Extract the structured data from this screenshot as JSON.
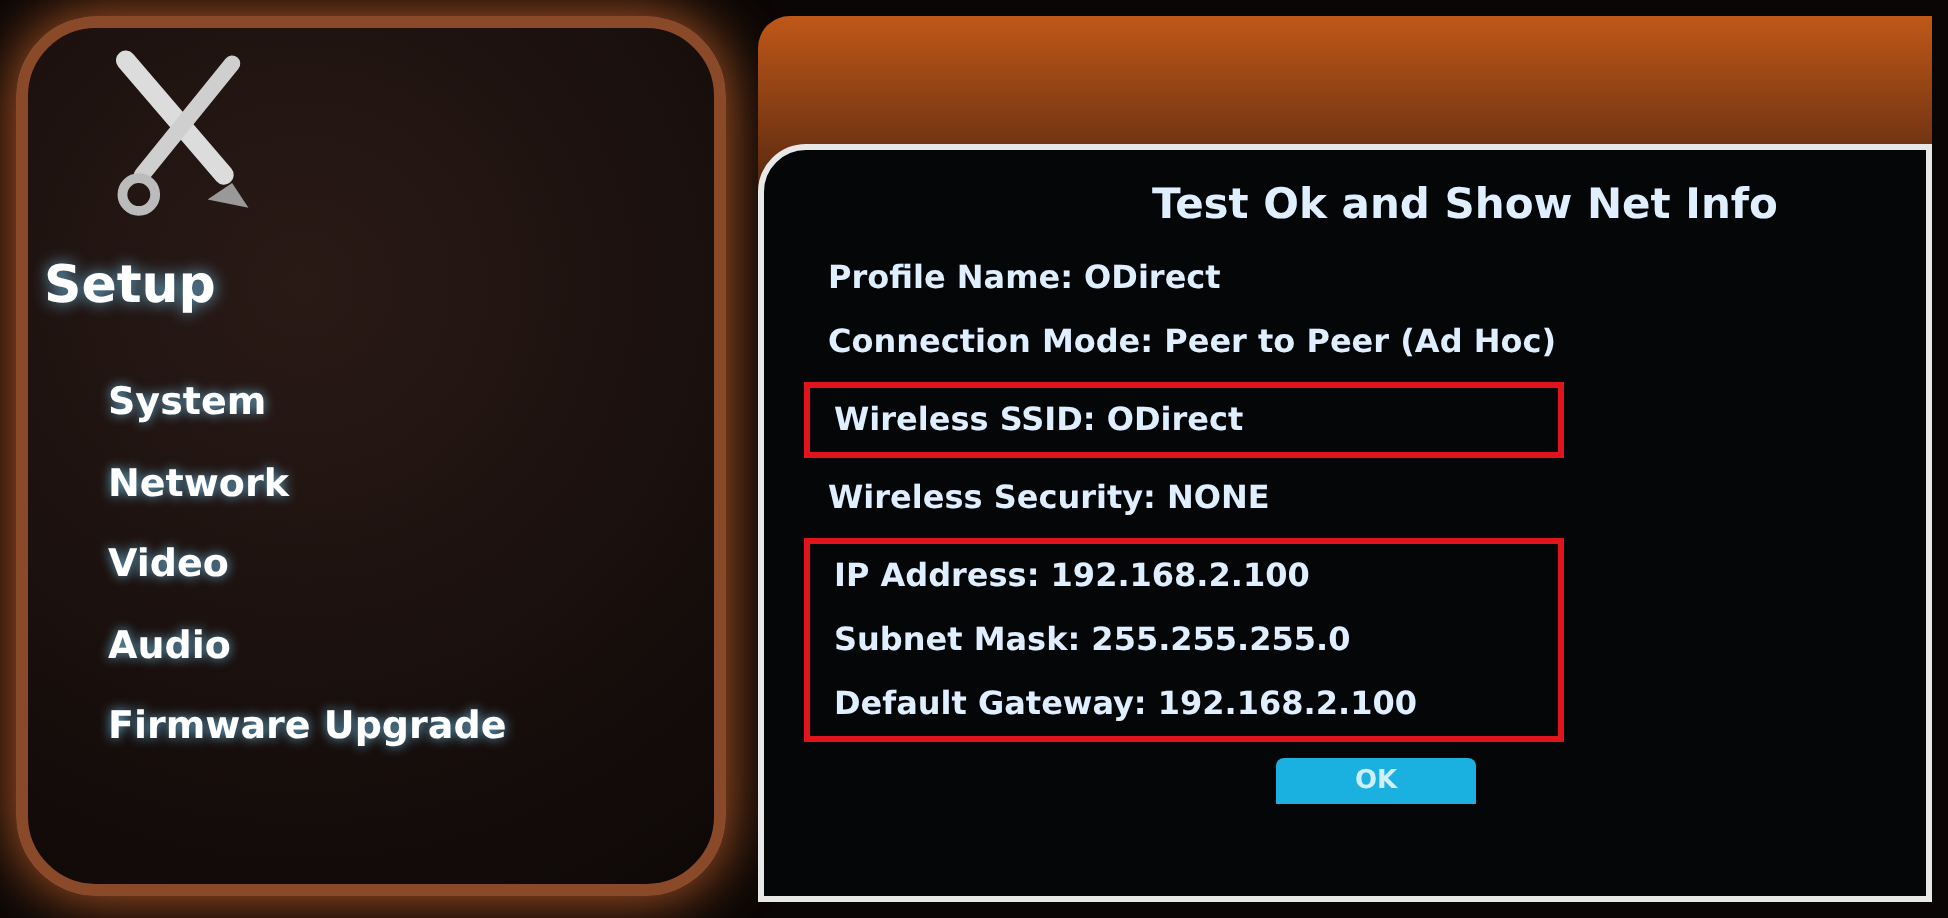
{
  "sidebar": {
    "title": "Setup",
    "items": [
      "System",
      "Network",
      "Video",
      "Audio",
      "Firmware Upgrade"
    ]
  },
  "dialog": {
    "title": "Test Ok and Show Net Info",
    "groups": [
      {
        "highlighted": false,
        "lines": [
          "Profile Name: ODirect",
          "Connection Mode: Peer to Peer (Ad Hoc)"
        ]
      },
      {
        "highlighted": true,
        "lines": [
          "Wireless SSID: ODirect"
        ]
      },
      {
        "highlighted": false,
        "lines": [
          "Wireless Security: NONE"
        ]
      },
      {
        "highlighted": true,
        "lines": [
          "IP Address: 192.168.2.100",
          "Subnet Mask: 255.255.255.0",
          "Default Gateway: 192.168.2.100"
        ]
      }
    ],
    "button": "OK"
  }
}
